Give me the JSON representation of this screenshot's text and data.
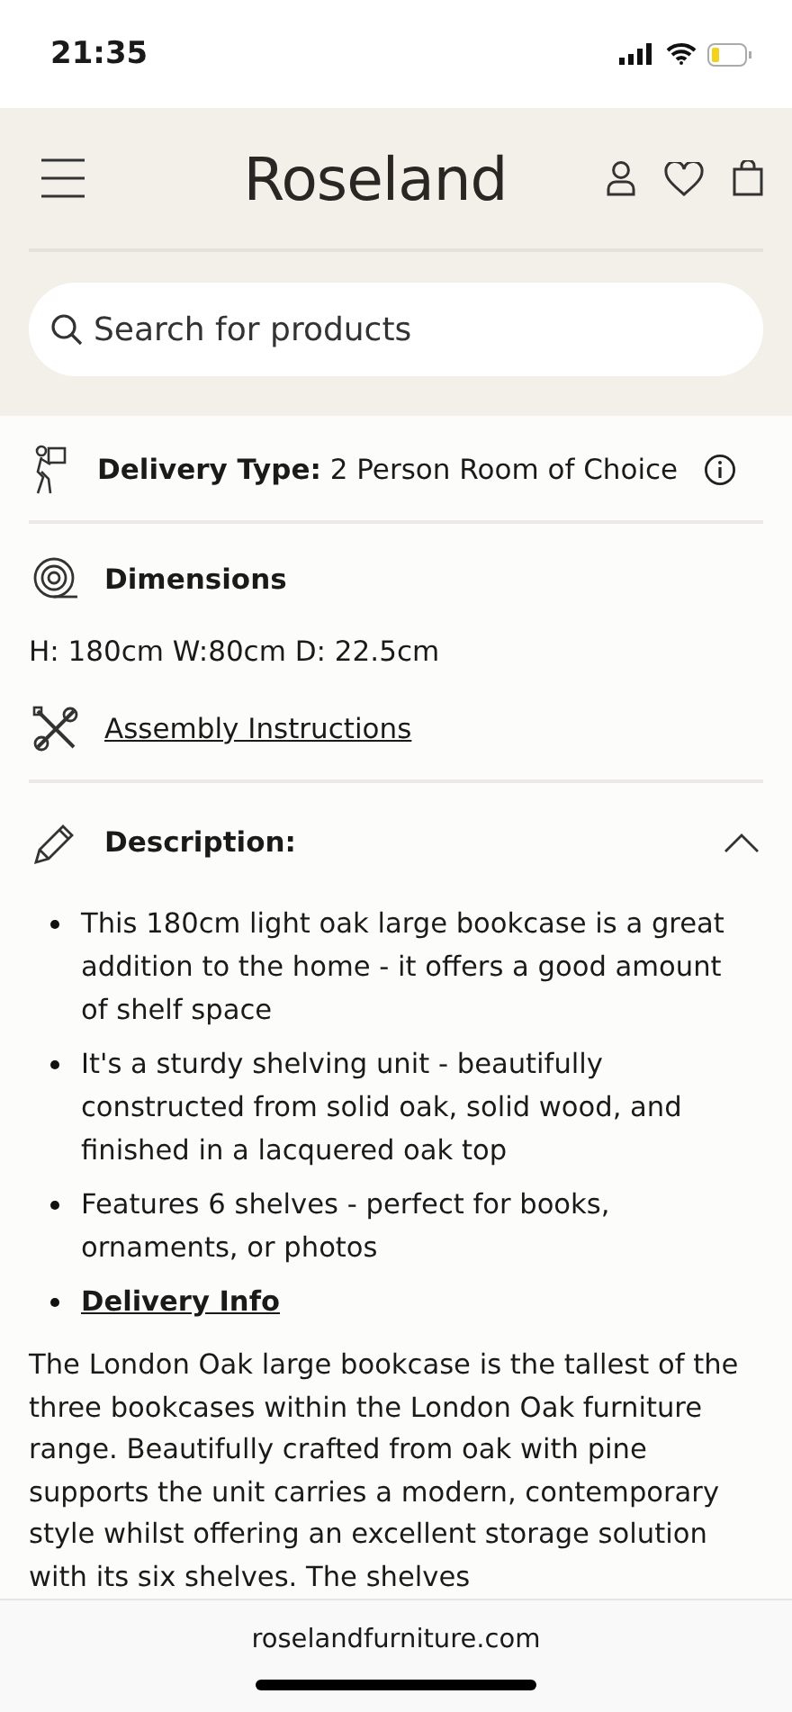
{
  "status_bar": {
    "time": "21:35"
  },
  "header": {
    "logo": "Roseland",
    "search": {
      "placeholder": "Search for products"
    }
  },
  "delivery": {
    "label": "Delivery Type:",
    "value": "2 Person Room of Choice"
  },
  "dimensions": {
    "title": "Dimensions",
    "value": "H: 180cm W:80cm D: 22.5cm"
  },
  "assembly": {
    "link": "Assembly Instructions"
  },
  "description": {
    "title": "Description:",
    "expanded": true,
    "bullets": [
      {
        "kind": "text",
        "text": "This 180cm light oak large bookcase is a great addition to the home - it offers a good amount of shelf space"
      },
      {
        "kind": "text",
        "text": "It's a sturdy shelving unit - beautifully constructed from solid oak, solid wood, and finished in a lacquered oak top"
      },
      {
        "kind": "text",
        "text": "Features 6 shelves - perfect for books, ornaments, or photos"
      },
      {
        "kind": "link",
        "text": "Delivery Info"
      }
    ],
    "paragraph": "The London Oak large bookcase is the tallest of the three bookcases within the London Oak furniture range. Beautifully crafted from oak with pine supports the unit carries a modern, contemporary style whilst offering an excellent storage solution with its six shelves. The shelves"
  },
  "browser": {
    "url": "roselandfurniture.com"
  }
}
